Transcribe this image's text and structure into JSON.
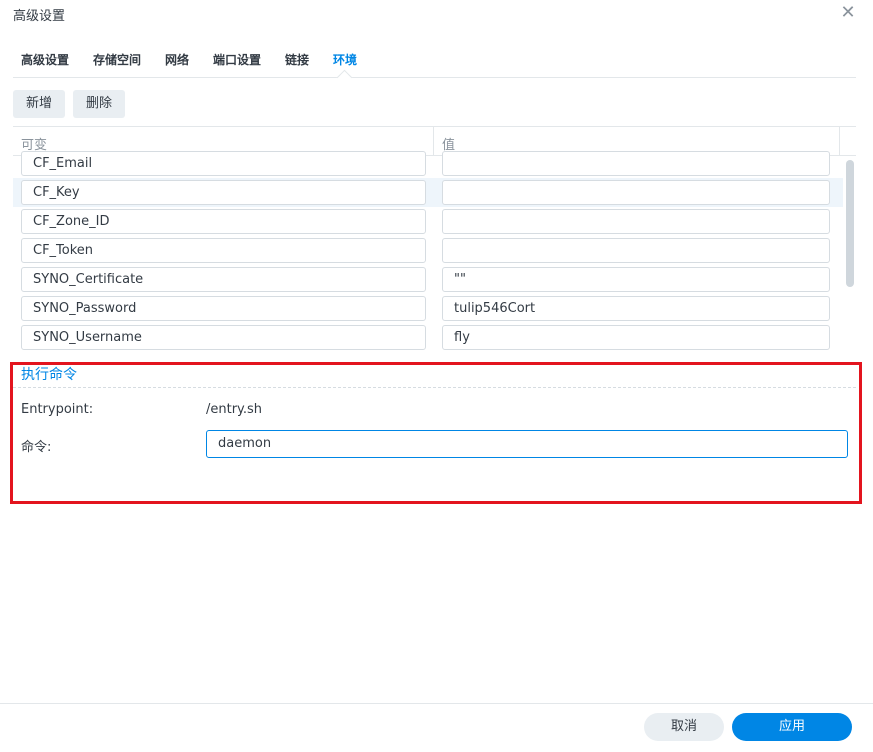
{
  "window": {
    "title": "高级设置"
  },
  "tabs": [
    {
      "label": "高级设置"
    },
    {
      "label": "存储空间"
    },
    {
      "label": "网络"
    },
    {
      "label": "端口设置"
    },
    {
      "label": "链接"
    },
    {
      "label": "环境",
      "active": true
    }
  ],
  "toolbar": {
    "add_label": "新增",
    "delete_label": "删除"
  },
  "env_table": {
    "headers": [
      "可变",
      "值"
    ],
    "rows": [
      {
        "key": "CF_Email",
        "value": ""
      },
      {
        "key": "CF_Key",
        "value": "",
        "selected": true
      },
      {
        "key": "CF_Zone_ID",
        "value": ""
      },
      {
        "key": "CF_Token",
        "value": ""
      },
      {
        "key": "SYNO_Certificate",
        "value": "\"\""
      },
      {
        "key": "SYNO_Password",
        "value": "tulip546Cort"
      },
      {
        "key": "SYNO_Username",
        "value": "fly"
      }
    ]
  },
  "execute": {
    "section_title": "执行命令",
    "entrypoint_label": "Entrypoint:",
    "entrypoint_value": "/entry.sh",
    "command_label": "命令:",
    "command_value": "daemon"
  },
  "footer": {
    "cancel_label": "取消",
    "apply_label": "应用"
  },
  "colors": {
    "accent": "#0086e5",
    "highlight_border": "#e3141e"
  }
}
